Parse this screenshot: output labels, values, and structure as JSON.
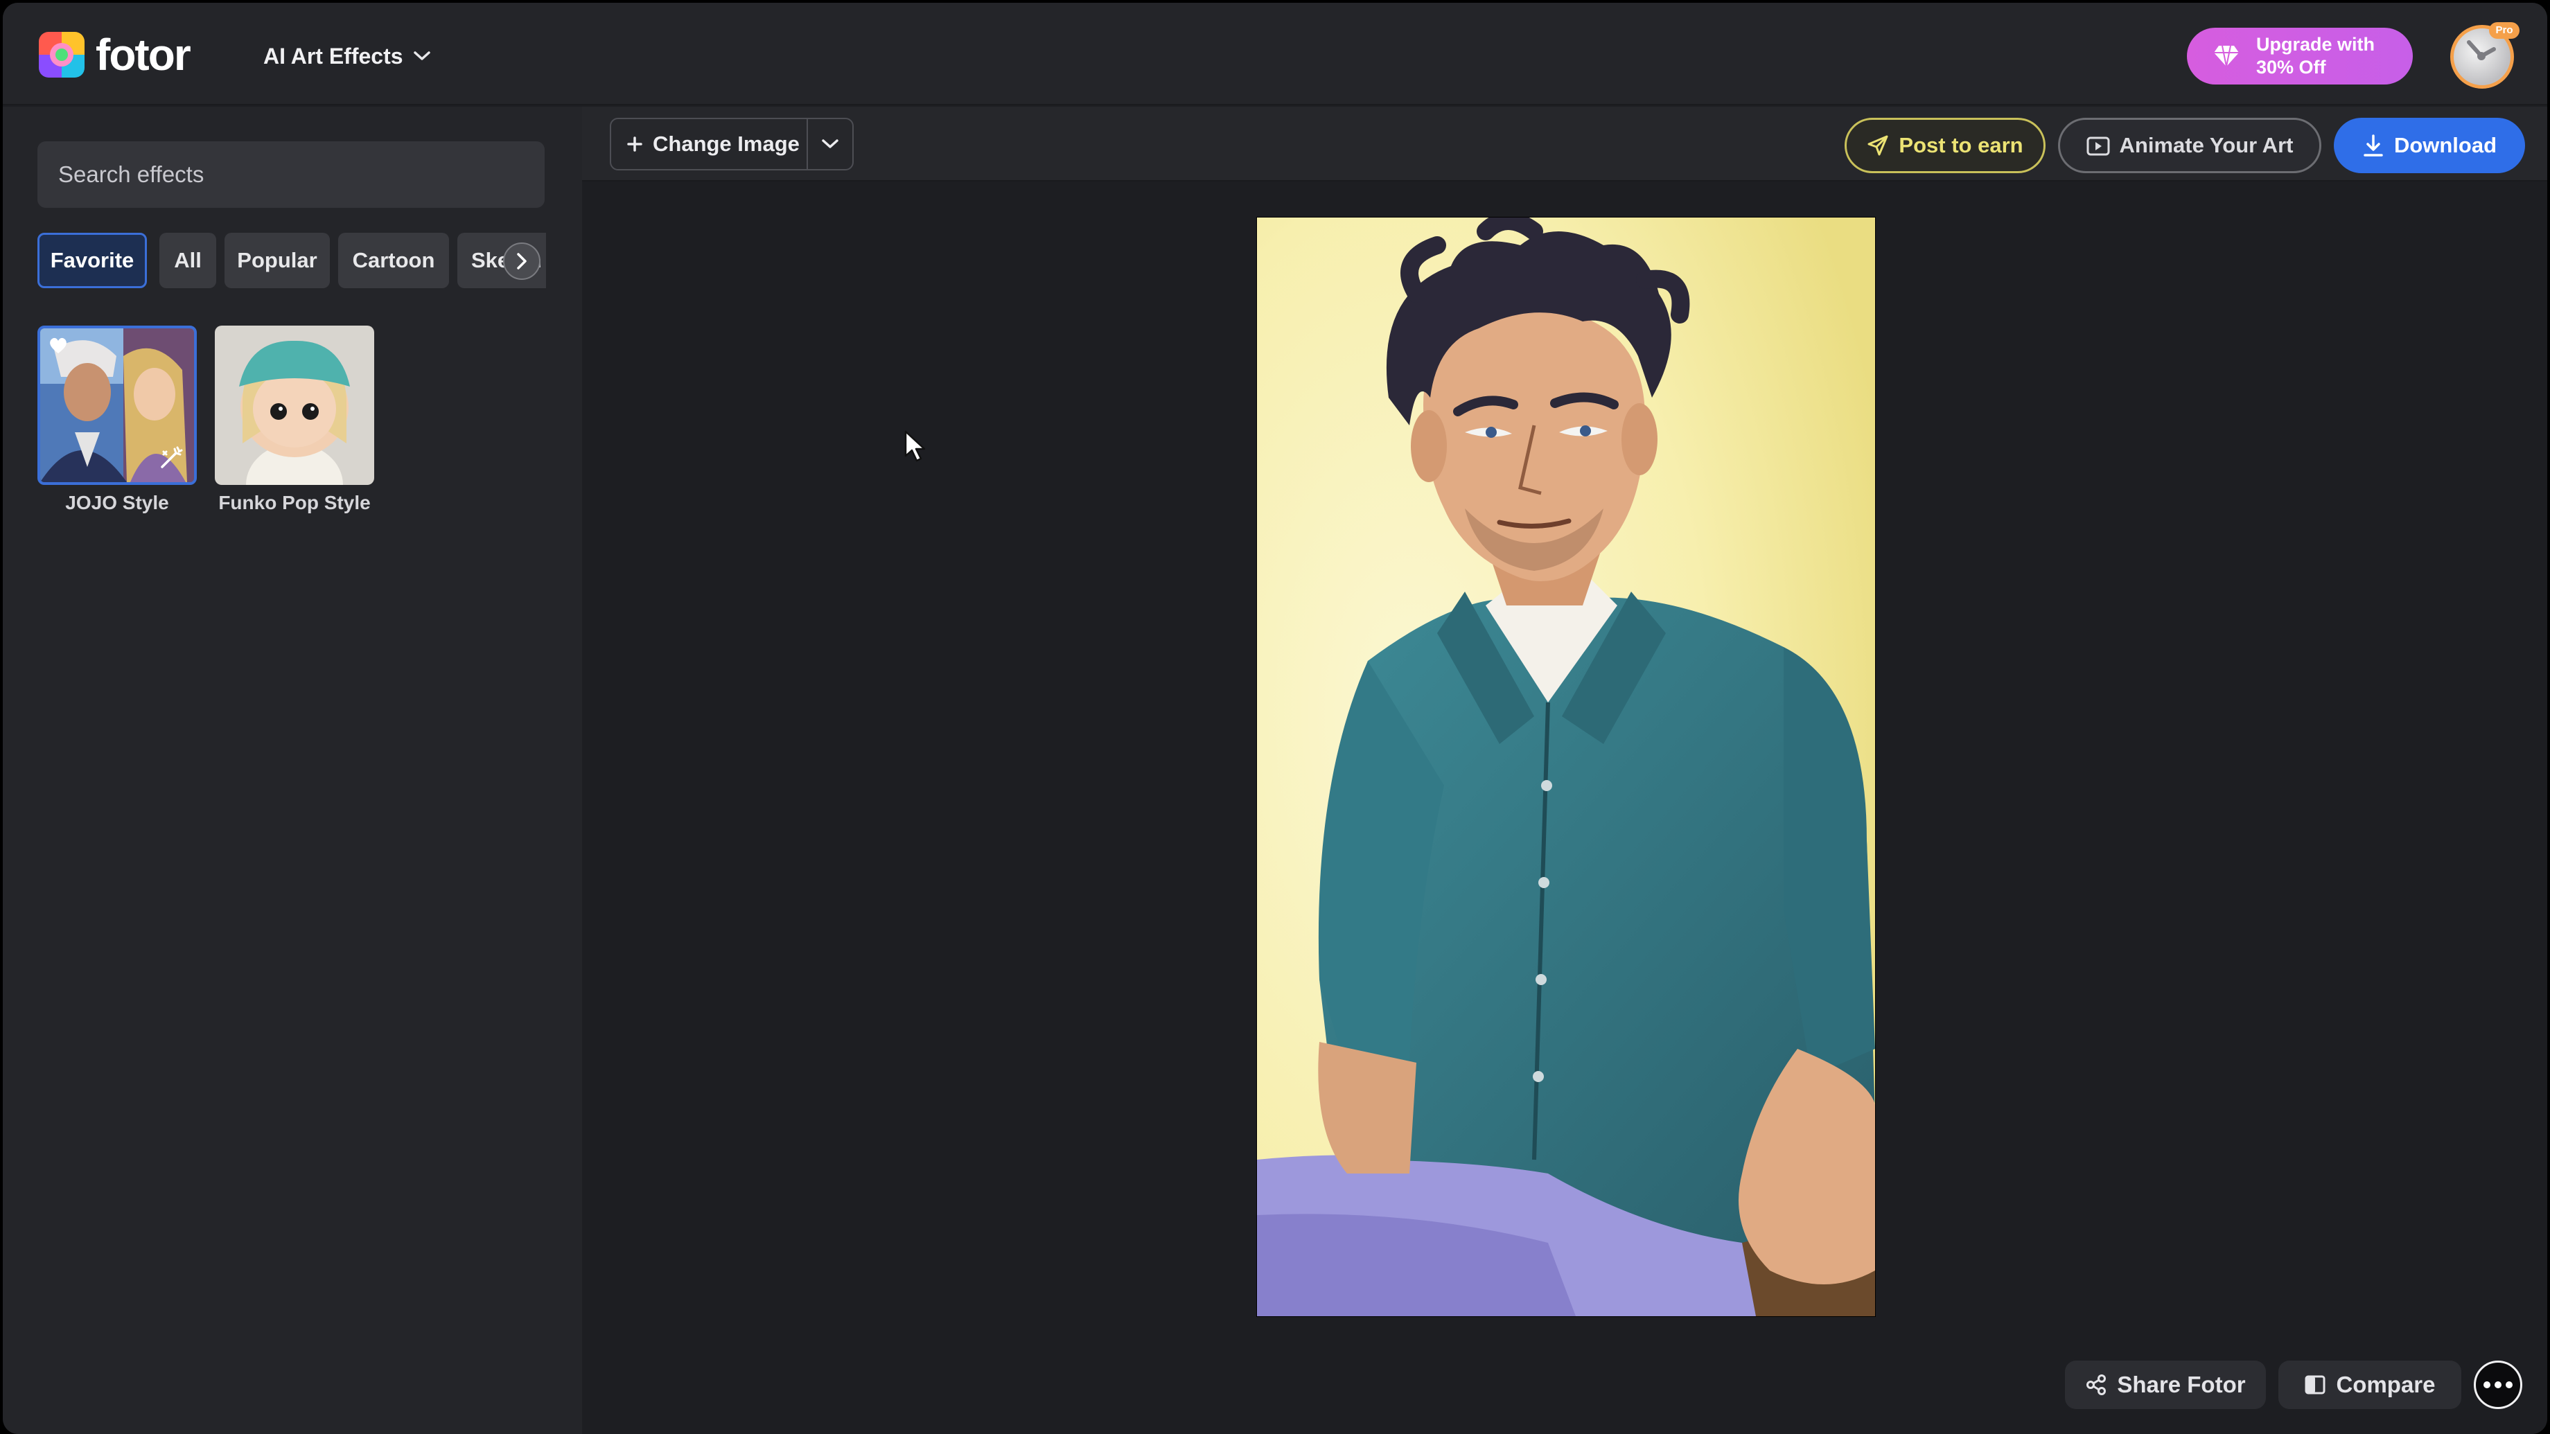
{
  "app": {
    "logo_text": "fotor"
  },
  "header": {
    "menu_label": "AI Art Effects",
    "upgrade_line1": "Upgrade with",
    "upgrade_line2": "30% Off",
    "pro_badge": "Pro"
  },
  "sidebar": {
    "search_placeholder": "Search effects",
    "tabs": [
      {
        "label": "Favorite",
        "active": true
      },
      {
        "label": "All"
      },
      {
        "label": "Popular"
      },
      {
        "label": "Cartoon"
      },
      {
        "label": "Sketch"
      }
    ],
    "effects": [
      {
        "name": "JOJO Style",
        "selected": true
      },
      {
        "name": "Funko Pop Style"
      }
    ]
  },
  "toolbar": {
    "change_image": "Change Image",
    "post_to_earn": "Post to earn",
    "animate": "Animate Your Art",
    "download": "Download"
  },
  "canvas": {
    "share": "Share Fotor",
    "compare": "Compare"
  },
  "colors": {
    "accent_blue": "#2f6ee8",
    "upgrade_pink": "#d65ddf",
    "post_yellow": "#ece374",
    "panel_dark": "#242529"
  }
}
